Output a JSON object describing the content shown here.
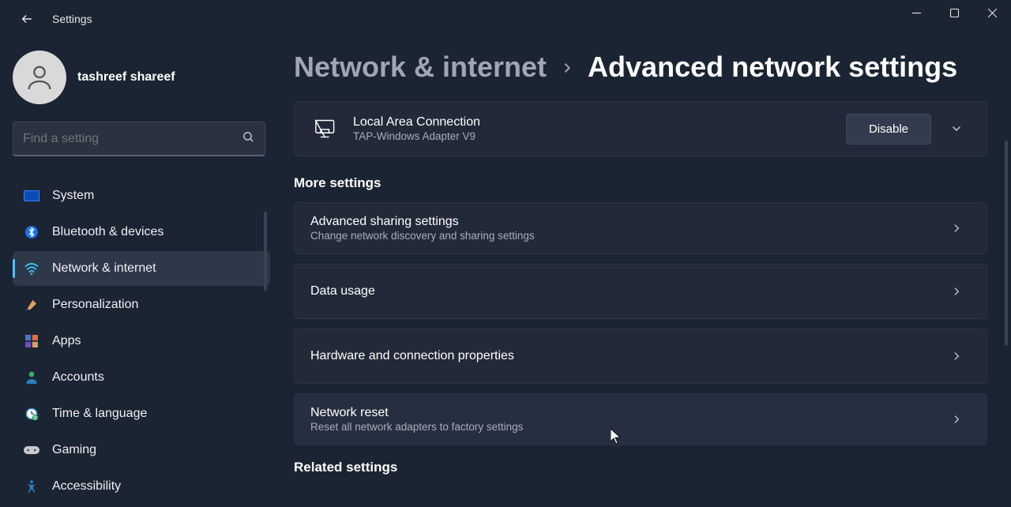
{
  "window": {
    "title": "Settings"
  },
  "user": {
    "name": "tashreef shareef"
  },
  "search": {
    "placeholder": "Find a setting"
  },
  "sidebar": {
    "items": [
      {
        "label": "System",
        "icon": "system"
      },
      {
        "label": "Bluetooth & devices",
        "icon": "bluetooth"
      },
      {
        "label": "Network & internet",
        "icon": "wifi"
      },
      {
        "label": "Personalization",
        "icon": "brush"
      },
      {
        "label": "Apps",
        "icon": "apps"
      },
      {
        "label": "Accounts",
        "icon": "person"
      },
      {
        "label": "Time & language",
        "icon": "clock"
      },
      {
        "label": "Gaming",
        "icon": "gamepad"
      },
      {
        "label": "Accessibility",
        "icon": "accessibility"
      }
    ],
    "active_index": 2
  },
  "breadcrumb": {
    "parent": "Network & internet",
    "current": "Advanced network settings"
  },
  "adapter": {
    "title": "Local Area Connection",
    "subtitle": "TAP-Windows Adapter V9",
    "action": "Disable"
  },
  "sections": {
    "more_settings": "More settings",
    "related_settings": "Related settings"
  },
  "more_settings": [
    {
      "title": "Advanced sharing settings",
      "subtitle": "Change network discovery and sharing settings"
    },
    {
      "title": "Data usage",
      "subtitle": ""
    },
    {
      "title": "Hardware and connection properties",
      "subtitle": ""
    },
    {
      "title": "Network reset",
      "subtitle": "Reset all network adapters to factory settings"
    }
  ]
}
